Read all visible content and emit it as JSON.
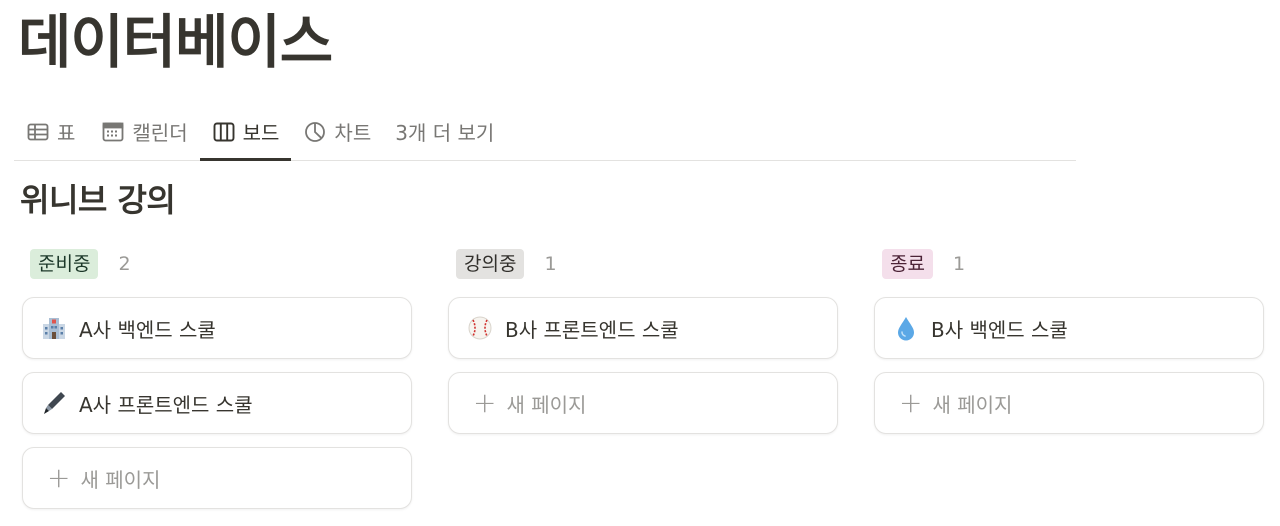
{
  "page": {
    "title": "데이터베이스"
  },
  "views": [
    {
      "label": "표",
      "icon": "table-icon",
      "active": false
    },
    {
      "label": "캘린더",
      "icon": "calendar-icon",
      "active": false
    },
    {
      "label": "보드",
      "icon": "board-icon",
      "active": true
    },
    {
      "label": "차트",
      "icon": "chart-icon",
      "active": false
    },
    {
      "label": "3개 더 보기",
      "icon": "",
      "active": false
    }
  ],
  "board": {
    "title": "위니브 강의",
    "new_page_label": "새 페이지",
    "columns": [
      {
        "status": "준비중",
        "status_bg": "#dbeddb",
        "status_color": "#1c3829",
        "count": "2",
        "cards": [
          {
            "title": "A사 백엔드 스쿨",
            "emoji": "school-building-icon"
          },
          {
            "title": "A사 프론트엔드 스쿨",
            "emoji": "pen-icon"
          }
        ]
      },
      {
        "status": "강의중",
        "status_bg": "#e3e2e0",
        "status_color": "#32302c",
        "count": "1",
        "cards": [
          {
            "title": "B사 프론트엔드 스쿨",
            "emoji": "baseball-icon"
          }
        ]
      },
      {
        "status": "종료",
        "status_bg": "#f4dfeb",
        "status_color": "#4c2337",
        "count": "1",
        "cards": [
          {
            "title": "B사 백엔드 스쿨",
            "emoji": "water-drop-icon"
          }
        ]
      }
    ]
  }
}
